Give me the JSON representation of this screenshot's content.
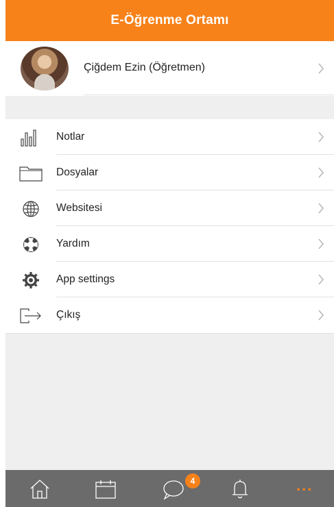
{
  "header": {
    "title": "E-Öğrenme Ortamı"
  },
  "profile": {
    "name": "Çiğdem Ezin (Öğretmen)"
  },
  "menu": {
    "items": [
      {
        "label": "Notlar",
        "icon": "bar-chart-icon"
      },
      {
        "label": "Dosyalar",
        "icon": "folder-icon"
      },
      {
        "label": "Websitesi",
        "icon": "globe-icon"
      },
      {
        "label": "Yardım",
        "icon": "lifebuoy-icon"
      },
      {
        "label": "App settings",
        "icon": "gear-icon"
      },
      {
        "label": "Çıkış",
        "icon": "logout-icon"
      }
    ]
  },
  "tabbar": {
    "messages_badge": "4",
    "more_label": "..."
  },
  "colors": {
    "accent": "#f7821a",
    "tabbar": "#6b6b6b",
    "background": "#efefef"
  }
}
